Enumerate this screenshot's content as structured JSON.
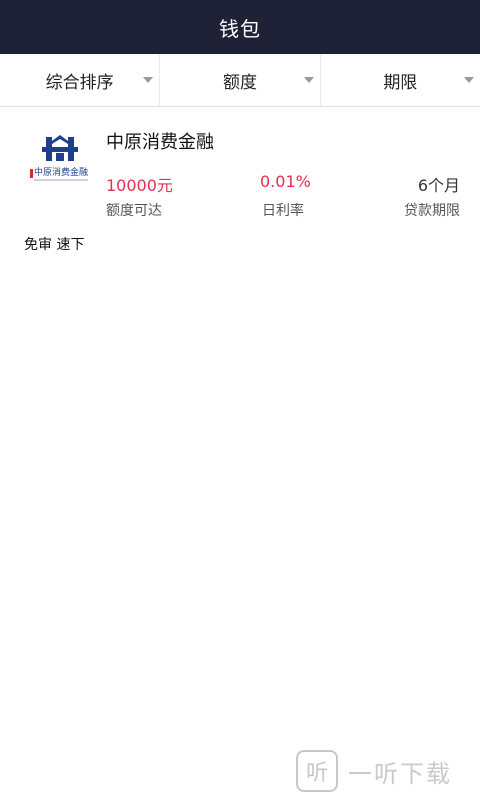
{
  "header": {
    "title": "钱包"
  },
  "filters": [
    {
      "label": "综合排序"
    },
    {
      "label": "额度"
    },
    {
      "label": "期限"
    }
  ],
  "product": {
    "name": "中原消费金融",
    "logo_text": "中原消费金融",
    "amount_value": "10000元",
    "amount_caption": "额度可达",
    "rate_value": "0.01%",
    "rate_caption": "日利率",
    "term_value": "6个月",
    "term_caption": "贷款期限",
    "tags": "免审 速下"
  },
  "watermark": {
    "icon_char": "听",
    "text": "一听下载"
  },
  "colors": {
    "header_bg": "#1f2236",
    "accent_red": "#e0314f",
    "logo_blue": "#1e3f8a"
  }
}
